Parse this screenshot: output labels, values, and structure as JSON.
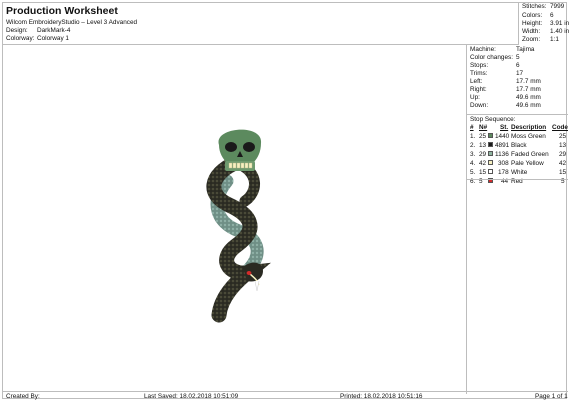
{
  "header": {
    "title": "Production Worksheet",
    "software": "Wilcom EmbroideryStudio – Level 3 Advanced",
    "design_label": "Design:",
    "design_value": "DarkMark-4",
    "colorway_label": "Colorway:",
    "colorway_value": "Colorway 1"
  },
  "stats": [
    {
      "label": "Stitches:",
      "value": "7999"
    },
    {
      "label": "Colors:",
      "value": "6"
    },
    {
      "label": "Height:",
      "value": "3.91 in"
    },
    {
      "label": "Width:",
      "value": "1.40 in"
    },
    {
      "label": "Zoom:",
      "value": "1:1"
    }
  ],
  "machine_info": [
    {
      "label": "Machine:",
      "value": "Tajima"
    },
    {
      "label": "Color changes:",
      "value": "5"
    },
    {
      "label": "Stops:",
      "value": "6"
    },
    {
      "label": "Trims:",
      "value": "17"
    },
    {
      "label": "Left:",
      "value": "17.7 mm"
    },
    {
      "label": "Right:",
      "value": "17.7 mm"
    },
    {
      "label": "Up:",
      "value": "49.6 mm"
    },
    {
      "label": "Down:",
      "value": "49.6 mm"
    }
  ],
  "stop_sequence": {
    "title": "Stop Sequence:",
    "headers": {
      "num": "#",
      "n": "N#",
      "st": "St.",
      "desc": "Description",
      "code": "Code"
    },
    "rows": [
      {
        "num": "1.",
        "n": "25",
        "swatch": "#5c8a5e",
        "st": "1440",
        "desc": "Moss Green",
        "code": "25"
      },
      {
        "num": "2.",
        "n": "13",
        "swatch": "#1a1a1a",
        "st": "4891",
        "desc": "Black",
        "code": "13"
      },
      {
        "num": "3.",
        "n": "29",
        "swatch": "#8fb5a0",
        "st": "1136",
        "desc": "Faded Green",
        "code": "29"
      },
      {
        "num": "4.",
        "n": "42",
        "swatch": "#f6f0c0",
        "st": "308",
        "desc": "Pale Yellow",
        "code": "42"
      },
      {
        "num": "5.",
        "n": "15",
        "swatch": "#ffffff",
        "st": "178",
        "desc": "White",
        "code": "15"
      },
      {
        "num": "6.",
        "n": "5",
        "swatch": "#d42a2a",
        "st": "44",
        "desc": "Red",
        "code": "5"
      }
    ]
  },
  "footer": {
    "created_by": "Created By:",
    "last_saved": "Last Saved: 18.02.2018 10:51:09",
    "printed": "Printed: 18.02.2018 10:51:16",
    "page": "Page 1 of 1"
  }
}
